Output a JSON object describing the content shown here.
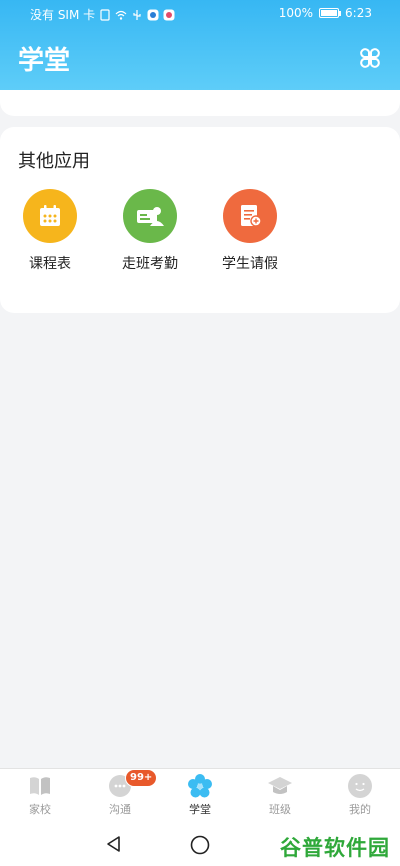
{
  "status_bar": {
    "carrier": "没有 SIM 卡",
    "battery": "100%",
    "time": "6:23"
  },
  "header": {
    "title": "学堂",
    "apps_icon": "four-petal-grid-icon"
  },
  "other_apps": {
    "title": "其他应用",
    "items": [
      {
        "label": "课程表",
        "icon": "calendar-icon",
        "color": "#f6b51c"
      },
      {
        "label": "走班考勤",
        "icon": "id-card-icon",
        "color": "#6ab84a"
      },
      {
        "label": "学生请假",
        "icon": "leave-form-icon",
        "color": "#ef6a3e"
      }
    ]
  },
  "tabbar": {
    "tabs": [
      {
        "label": "家校",
        "icon": "book-icon",
        "active": false
      },
      {
        "label": "沟通",
        "icon": "chat-icon",
        "badge": "99+",
        "active": false
      },
      {
        "label": "学堂",
        "icon": "flower-icon",
        "active": true
      },
      {
        "label": "班级",
        "icon": "graduation-cap-icon",
        "active": false
      },
      {
        "label": "我的",
        "icon": "face-icon",
        "active": false
      }
    ]
  },
  "watermark": "谷普软件园",
  "colors": {
    "header_start": "#37b7f3",
    "header_end": "#5ecdf8",
    "active_tab_icon": "#3bbcf2",
    "badge": "#e8592b"
  }
}
